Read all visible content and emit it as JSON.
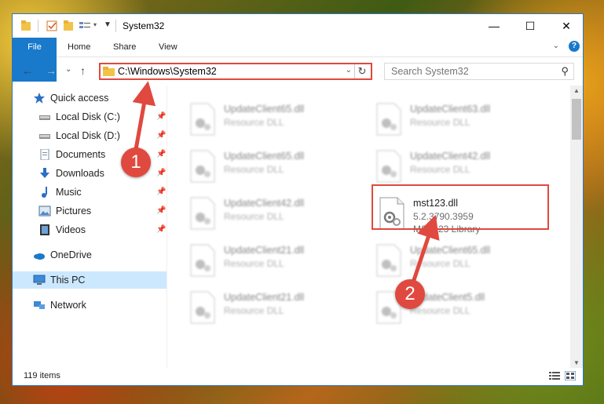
{
  "window": {
    "title": "System32",
    "controls": {
      "minimize": "—",
      "maximize": "☐",
      "close": "✕"
    }
  },
  "ribbon": {
    "tabs": [
      "File",
      "Home",
      "Share",
      "View"
    ],
    "expand_icon": "chevron-down-icon",
    "help_icon": "?"
  },
  "nav": {
    "back": "←",
    "forward": "→",
    "recent": "⌄",
    "up": "↑",
    "address": "C:\\Windows\\System32",
    "search_placeholder": "Search System32"
  },
  "sidebar": {
    "items": [
      {
        "label": "Quick access",
        "icon": "star-icon",
        "pinned": false
      },
      {
        "label": "Local Disk (C:)",
        "icon": "drive-icon",
        "pinned": true
      },
      {
        "label": "Local Disk (D:)",
        "icon": "drive-icon",
        "pinned": true
      },
      {
        "label": "Documents",
        "icon": "documents-icon",
        "pinned": true
      },
      {
        "label": "Downloads",
        "icon": "download-icon",
        "pinned": true
      },
      {
        "label": "Music",
        "icon": "music-icon",
        "pinned": true
      },
      {
        "label": "Pictures",
        "icon": "pictures-icon",
        "pinned": true
      },
      {
        "label": "Videos",
        "icon": "videos-icon",
        "pinned": true
      },
      {
        "label": "OneDrive",
        "icon": "cloud-icon",
        "pinned": false
      },
      {
        "label": "This PC",
        "icon": "computer-icon",
        "pinned": false,
        "selected": true
      },
      {
        "label": "Network",
        "icon": "network-icon",
        "pinned": false
      }
    ]
  },
  "files": [
    {
      "name": "UpdateClient65.dll",
      "desc": "Resource DLL"
    },
    {
      "name": "UpdateClient63.dll",
      "desc": "Resource DLL"
    },
    {
      "name": "UpdateClient65.dll",
      "desc": "Resource DLL"
    },
    {
      "name": "UpdateClient42.dll",
      "desc": "Resource DLL"
    },
    {
      "name": "UpdateClient42.dll",
      "desc": "Resource DLL"
    },
    {
      "name": "mst123.dll",
      "version": "5.2.3790.3959",
      "desc": "MST123 Library"
    },
    {
      "name": "UpdateClient21.dll",
      "desc": "Resource DLL"
    },
    {
      "name": "UpdateClient65.dll",
      "desc": "Resource DLL"
    },
    {
      "name": "UpdateClient21.dll",
      "desc": "Resource DLL"
    },
    {
      "name": "UpdateClient5.dll",
      "desc": "Resource DLL"
    }
  ],
  "status": {
    "item_count": "119 items"
  },
  "annotations": {
    "step1": "1",
    "step2": "2"
  },
  "colors": {
    "accent": "#1979ca",
    "highlight": "#e0493f",
    "selection": "#cce8ff"
  }
}
